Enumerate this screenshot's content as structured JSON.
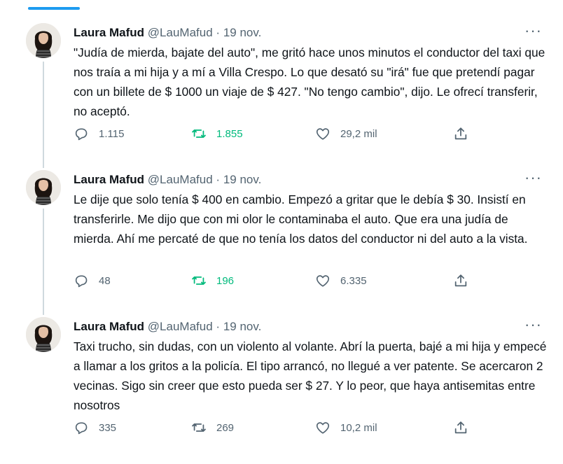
{
  "colors": {
    "accent": "#1d9bf0",
    "retweet_green": "#00ba7c",
    "muted": "#536471",
    "thread_line": "#cfd9de"
  },
  "tweets": [
    {
      "name": "Laura Mafud",
      "handle": "@LauMafud",
      "separator": "·",
      "date": "19 nov.",
      "more": "···",
      "text": "\"Judía de mierda, bajate del auto\", me gritó hace unos minutos el conductor del taxi que nos traía a mi hija y a mí a Villa Crespo. Lo que desató su \"irá\" fue que pretendí pagar con un billete de $ 1000 un viaje de $ 427. \"No tengo cambio\", dijo. Le ofrecí transferir, no aceptó.",
      "replies": "1.115",
      "retweets": "1.855",
      "retweeted": true,
      "likes": "29,2 mil"
    },
    {
      "name": "Laura Mafud",
      "handle": "@LauMafud",
      "separator": "·",
      "date": "19 nov.",
      "more": "···",
      "text": "Le dije que solo tenía $ 400 en cambio. Empezó a gritar que le debía $ 30. Insistí en transferirle. Me dijo que con mi olor le contaminaba el auto. Que era una judía de mierda. Ahí me percaté de que no tenía los datos del conductor ni del auto a la vista.",
      "replies": "48",
      "retweets": "196",
      "retweeted": true,
      "likes": "6.335"
    },
    {
      "name": "Laura Mafud",
      "handle": "@LauMafud",
      "separator": "·",
      "date": "19 nov.",
      "more": "···",
      "text": "Taxi trucho, sin dudas, con un violento al volante. Abrí la puerta, bajé a mi hija y empecé a llamar a los gritos a la policía. El tipo arrancó, no llegué a ver patente. Se acercaron 2 vecinas. Sigo sin creer que esto pueda ser $ 27. Y lo peor, que haya antisemitas entre nosotros",
      "replies": "335",
      "retweets": "269",
      "retweeted": false,
      "likes": "10,2 mil"
    }
  ]
}
